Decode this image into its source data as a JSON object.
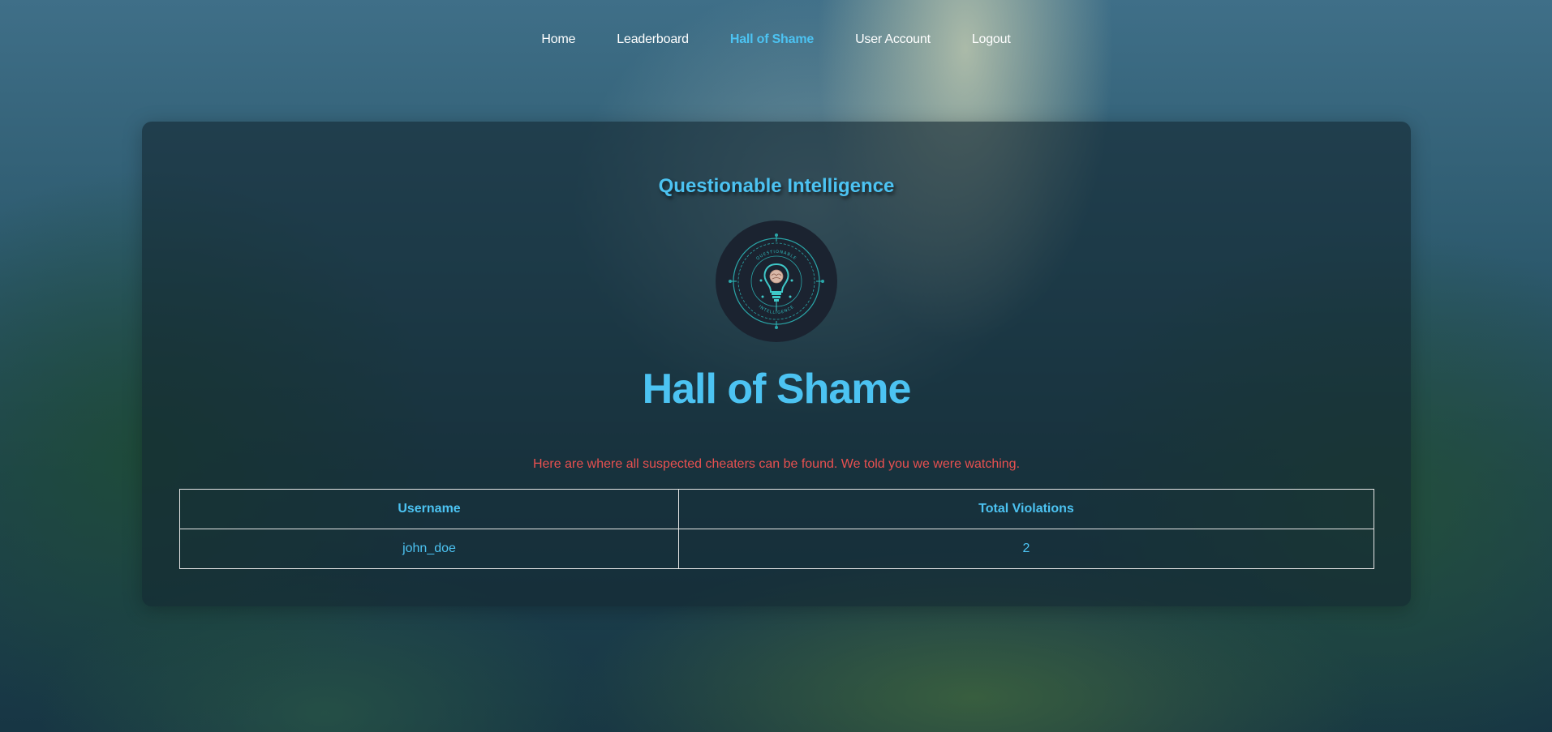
{
  "nav": {
    "items": [
      {
        "label": "Home",
        "active": false
      },
      {
        "label": "Leaderboard",
        "active": false
      },
      {
        "label": "Hall of Shame",
        "active": true
      },
      {
        "label": "User Account",
        "active": false
      },
      {
        "label": "Logout",
        "active": false
      }
    ]
  },
  "brand": {
    "name": "Questionable Intelligence",
    "logo_text_top": "QUESTIONABLE",
    "logo_text_bottom": "INTELLIGENCE"
  },
  "page": {
    "title": "Hall of Shame",
    "subtitle": "Here are where all suspected cheaters can be found. We told you we were watching."
  },
  "table": {
    "headers": [
      "Username",
      "Total Violations"
    ],
    "rows": [
      [
        "john_doe",
        "2"
      ]
    ]
  },
  "colors": {
    "accent": "#4cc3f2",
    "warning": "#e85050"
  }
}
